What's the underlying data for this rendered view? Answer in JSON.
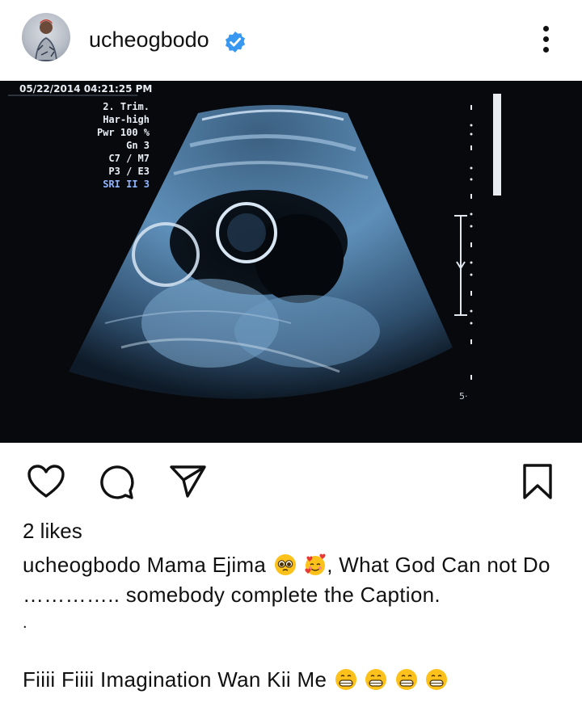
{
  "post": {
    "username": "ucheogbodo",
    "verified": true
  },
  "media": {
    "timestamp": "05/22/2014  04:21:25 PM",
    "params": [
      "2. Trim.",
      "Har-high",
      "Pwr 100 %",
      "Gn  3",
      "C7 / M7",
      "P3 / E3"
    ],
    "sri": "SRI II 3",
    "scale_label": "5·"
  },
  "engagement": {
    "likes": "2 likes"
  },
  "caption": {
    "username": "ucheogbodo",
    "text_a": "Mama Ejima",
    "text_b": ", What God Can not Do ………….. somebody complete the Caption.",
    "dot": ".",
    "line2": "Fiiii Fiiii Imagination Wan Kii Me",
    "emoji_row1": [
      "pleading-face",
      "smiling-face-with-hearts"
    ],
    "emoji_row2": [
      "grinning-face",
      "grinning-face",
      "grinning-face",
      "grinning-face"
    ]
  },
  "icons": {
    "like": "heart-icon",
    "comment": "comment-icon",
    "share": "send-icon",
    "save": "bookmark-icon",
    "more": "more-options-icon",
    "verified": "verified-badge-icon"
  },
  "colors": {
    "verified": "#3897f0",
    "ultrasound_bg": "#07090c",
    "ultrasound_tone": "#6f9ec6"
  }
}
